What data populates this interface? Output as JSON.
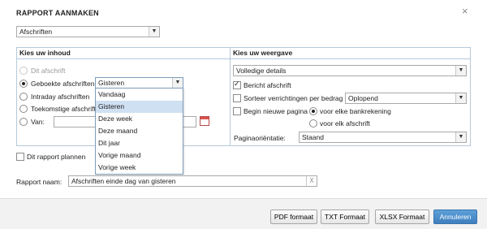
{
  "dialog": {
    "title": "RAPPORT AANMAKEN",
    "close_glyph": "×"
  },
  "report_type": {
    "value": "Afschriften"
  },
  "content_panel": {
    "header": "Kies uw inhoud",
    "options": [
      {
        "label": "Dit afschrift",
        "selected": false,
        "disabled": true
      },
      {
        "label": "Geboekte afschriften",
        "selected": true,
        "disabled": false
      },
      {
        "label": "Intraday afschriften",
        "selected": false,
        "disabled": false
      },
      {
        "label": "Toekomstige afschrifte",
        "selected": false,
        "disabled": false
      },
      {
        "label": "Van:",
        "selected": false,
        "disabled": false
      }
    ],
    "period_select": {
      "value": "Gisteren"
    },
    "period_options": [
      "Vandaag",
      "Gisteren",
      "Deze week",
      "Deze maand",
      "Dit jaar",
      "Vorige maand",
      "Vorige week"
    ],
    "period_selected_index": 1
  },
  "view_panel": {
    "header": "Kies uw weergave",
    "detail_select": {
      "value": "Volledige details"
    },
    "bericht_label": "Bericht afschrift",
    "bericht_checked": true,
    "sort_label": "Sorteer verrichtingen per bedrag",
    "sort_checked": false,
    "sort_select": {
      "value": "Oplopend"
    },
    "newpage_label": "Begin nieuwe pagina",
    "newpage_checked": false,
    "newpage_options": [
      {
        "label": "voor elke bankrekening",
        "selected": true
      },
      {
        "label": "voor elk afschrift",
        "selected": false
      }
    ],
    "orientation_label": "Paginaoriëntatie:",
    "orientation_select": {
      "value": "Staand"
    }
  },
  "schedule": {
    "label": "Dit rapport plannen",
    "checked": false
  },
  "report_name": {
    "label": "Rapport naam:",
    "value": "Afschriften einde dag van gisteren",
    "clear_glyph": "X"
  },
  "footer": {
    "pdf": "PDF formaat",
    "txt": "TXT Formaat",
    "xlsx": "XLSX Formaat",
    "cancel": "Annuleren"
  },
  "colors": {
    "primary_button": "#4a8cce",
    "panel_border": "#b5c9da",
    "selected_option": "#cfe0f2"
  }
}
